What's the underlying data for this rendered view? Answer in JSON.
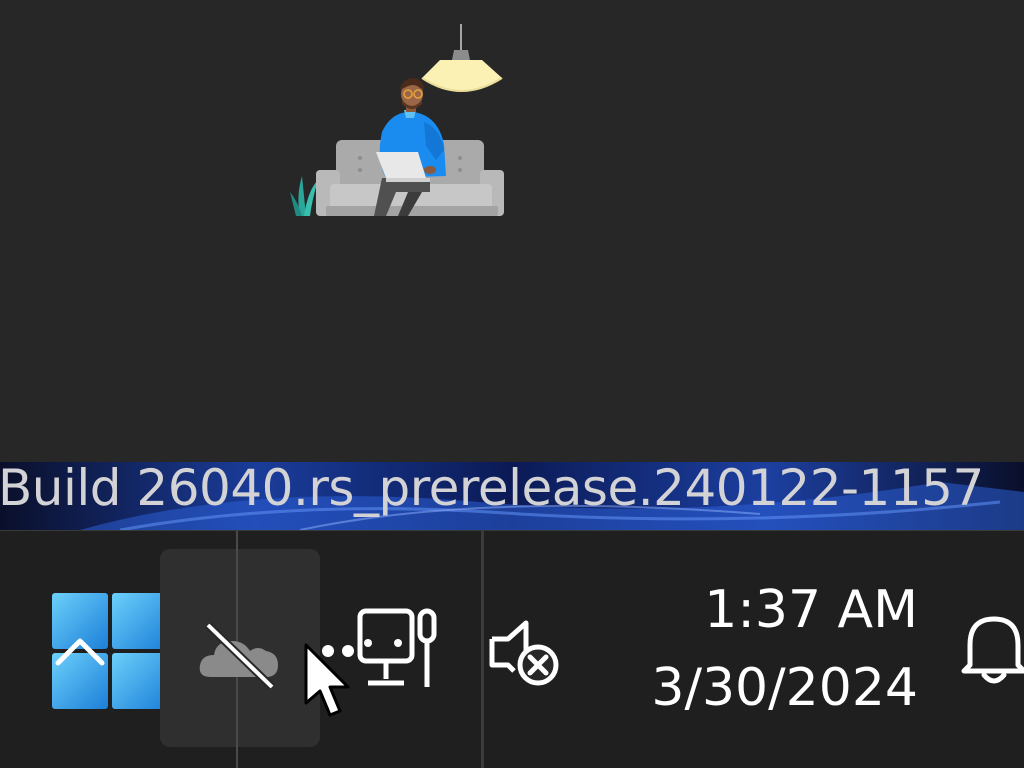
{
  "desktop": {
    "build_watermark": "Build 26040.rs_prerelease.240122-1157",
    "illustration": "person-on-couch-with-laptop"
  },
  "taskbar": {
    "start_icon": "windows-start-icon",
    "tray_icons": [
      "onedrive-offline-icon",
      "network-disconnected-icon",
      "volume-muted-icon"
    ],
    "clock": {
      "time": "1:37 AM",
      "date": "3/30/2024"
    },
    "notification_icon": "bell-icon"
  },
  "colors": {
    "desktop_bg": "#272727",
    "taskbar_bg": "#1f1f1f",
    "start_accent": "#3aa0ef",
    "shirt_blue": "#1a8cf0"
  }
}
